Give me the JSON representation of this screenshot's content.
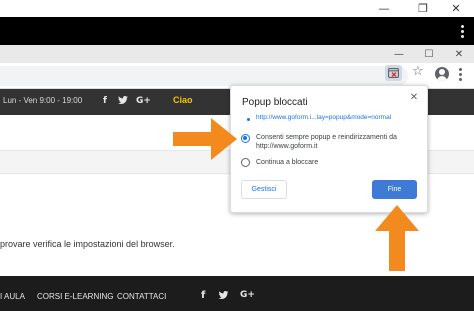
{
  "os_window": {
    "minimize_glyph": "—",
    "restore_glyph": "❐",
    "close_glyph": "✕"
  },
  "browser": {
    "minimize_glyph": "—",
    "maximize_glyph": "☐",
    "close_glyph": "✕",
    "toolbar_icons": [
      "popup-blocked-icon",
      "star-icon",
      "account-icon",
      "kebab-menu-icon"
    ],
    "star_glyph": "☆"
  },
  "site": {
    "hours": "Lun - Ven 9:00 - 19:00",
    "social": {
      "facebook": "f",
      "twitter": "🐦",
      "googleplus": "G+"
    },
    "greeting": "Ciao",
    "greeting_color": "#f5c400",
    "message": "provare verifica le impostazioni del browser.",
    "footer_links": [
      "I AULA",
      "CORSI E-LEARNING",
      "CONTATTACI"
    ]
  },
  "popup": {
    "title": "Popup bloccati",
    "close_glyph": "✕",
    "blocked_link": "http://www.goform.i...lay=popup&mode=normal",
    "option_allow_line1": "Consenti sempre popup e reindirizzamenti da",
    "option_allow_line2": "http://www.goform.it",
    "option_block": "Continua a bloccare",
    "selected_option": "allow",
    "manage_label": "Gestisci",
    "done_label": "Fine",
    "accent_color": "#1a73e8"
  },
  "annotations": {
    "arrow_color": "#f28a1e"
  }
}
